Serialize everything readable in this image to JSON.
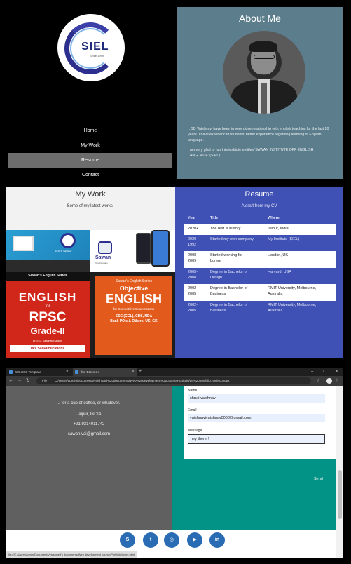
{
  "logo": {
    "text": "SIEL",
    "tagline": "Since 1999"
  },
  "nav": {
    "items": [
      "Home",
      "My Work",
      "Resume",
      "Contact"
    ],
    "active_index": 2
  },
  "about": {
    "title": "About Me",
    "paragraphs": [
      "I, SD Vaishnav, have been in very close relationship with english teaching for the last 20 years. I have experienced students' better experience regarding learning of English language.",
      "I am very glad to run this institute entitles 'SAWAN INSTITUTE OFF ENGLISH LANGUAGE' (SIEL)."
    ]
  },
  "work": {
    "title": "My Work",
    "subtitle": "Some of my latest works.",
    "tile1": {
      "caption": "Dr. R. S. Vaishnav"
    },
    "tile2": {
      "brand": "Sawan",
      "sub": "Teaching app"
    },
    "tile3": {
      "series": "Sawan's English Series",
      "line1": "ENGLISH",
      "line2": "for",
      "line3": "RPSC",
      "line4": "Grade-II",
      "author": "Dr. S. D. Vaishnav (Sawan)",
      "publisher": "M/s Sai Publications"
    },
    "tile4": {
      "series": "Sawan's English Series",
      "line1": "Objective",
      "line2": "ENGLISH",
      "line3": "for Competitive Examinations",
      "line4": "SSC (CGL), CDS, NDA",
      "line5": "Bank PO's & Others, UK, GK"
    }
  },
  "resume": {
    "title": "Resume",
    "subtitle": "A draft from my CV",
    "columns": [
      "Year",
      "Title",
      "Where"
    ],
    "rows": [
      {
        "year": "2020+",
        "title": "The rest is history..",
        "where": "Jaipur, India"
      },
      {
        "year": "2020-\n1992",
        "title": "Started my own company",
        "where": "My Institute (SIEL)"
      },
      {
        "year": "2008-\n2009",
        "title": "Started working for\nLorem",
        "where": "London, UK"
      },
      {
        "year": "2005-\n2008",
        "title": "Degree in Bachelor of\nDesign",
        "where": "Harvard, USA"
      },
      {
        "year": "2002-\n2005",
        "title": "Degree in Bachelor of\nBusiness",
        "where": "RMIT University, Melbourne,\nAustralia"
      },
      {
        "year": "2002-\n2005",
        "title": "Degree in Bachelor of\nBusiness",
        "where": "RMIT University, Melbourne,\nAustralia"
      }
    ]
  },
  "browser": {
    "tabs": [
      {
        "label": "W3.CSS Template"
      },
      {
        "label": "fun Dates c.s"
      }
    ],
    "url_prefix": "File",
    "url": "C:/Users/admin/Documents/vaishnavi%20documents/Web%20development%20course/Portfolio/de%20portfolio.html#contact",
    "status_url": "file:///C:/Users/admin/Documents/vaishnavi's documents/Web development course/Portfolio/index.html"
  },
  "contact": {
    "lines": [
      ".. for a cup of coffee, or whatever.",
      "Jaipur, INDIA",
      "+91 9314011742",
      "sawan.vai@gmail.com"
    ],
    "form": {
      "name_label": "Name",
      "name_value": "shruti vaishnav",
      "email_label": "Email",
      "email_value": "vaishnavivaishnav0000@gmail.com",
      "message_label": "Message",
      "message_value": "hey there!!!",
      "send_label": "Send"
    }
  },
  "social": [
    {
      "icon": "skype-icon",
      "glyph": "S"
    },
    {
      "icon": "twitter-icon",
      "glyph": "t"
    },
    {
      "icon": "instagram-icon",
      "glyph": "◎"
    },
    {
      "icon": "youtube-icon",
      "glyph": "▶"
    },
    {
      "icon": "linkedin-icon",
      "glyph": "in"
    }
  ],
  "colors": {
    "about_bg": "#5b7d8c",
    "resume_bg": "#3f51b5",
    "contact_right": "#039286",
    "contact_left": "#606060",
    "social": "#2a6cb3"
  }
}
